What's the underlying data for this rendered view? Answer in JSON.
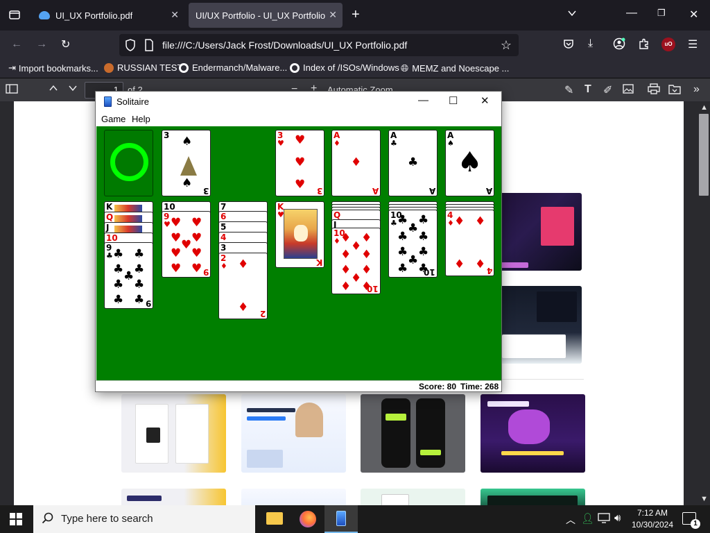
{
  "browser": {
    "tabs": [
      {
        "title": "UI_UX Portfolio.pdf",
        "active": false
      },
      {
        "title": "UI/UX Portfolio - UI_UX Portfolio.pdf",
        "active": true
      }
    ],
    "new_tab": "+",
    "url": "file:///C:/Users/Jack Frost/Downloads/UI_UX Portfolio.pdf",
    "addon_badge": "uO",
    "bookmarks": [
      "Import bookmarks...",
      "RUSSIAN TEST",
      "Endermanch/Malware...",
      "Index of /ISOs/Windows",
      "MEMZ and Noescape ..."
    ]
  },
  "pdf_toolbar": {
    "page_number": "1",
    "page_count": "of 2",
    "zoom": "Automatic Zoom"
  },
  "solitaire": {
    "title": "Solitaire",
    "menu": [
      "Game",
      "Help"
    ],
    "score_label": "Score: 80",
    "time_label": "Time: 268",
    "score": 80,
    "time": 268,
    "waste_card": {
      "rank": "3",
      "suit": "♠"
    },
    "foundations": [
      {
        "rank": "3",
        "suit": "♥"
      },
      {
        "rank": "A",
        "suit": "♦"
      },
      {
        "rank": "A",
        "suit": "♣"
      },
      {
        "rank": "A",
        "suit": "♠"
      }
    ],
    "tableau_top_cards": [
      {
        "rank": "9",
        "suit": "♣"
      },
      {
        "rank": "9",
        "suit": "♥"
      },
      {
        "rank": "2",
        "suit": "♦"
      },
      {
        "rank": "K",
        "suit": "♥"
      },
      {
        "rank": "10",
        "suit": "♦"
      },
      {
        "rank": "10",
        "suit": "♣"
      },
      {
        "rank": "4",
        "suit": "♦"
      }
    ],
    "peek_ranks": {
      "pile1": [
        "K",
        "Q",
        "J",
        "10"
      ],
      "pile2": [
        "10"
      ],
      "pile3": [
        "7",
        "6",
        "5",
        "4",
        "3"
      ],
      "pile5": [
        "Q",
        "J"
      ]
    }
  },
  "taskbar": {
    "search_placeholder": "Type here to search",
    "time": "7:12 AM",
    "date": "10/30/2024",
    "notification_count": "1"
  },
  "colors": {
    "felt": "#007f00",
    "red_suit": "#e00000",
    "stock_ring": "#00ff00"
  }
}
